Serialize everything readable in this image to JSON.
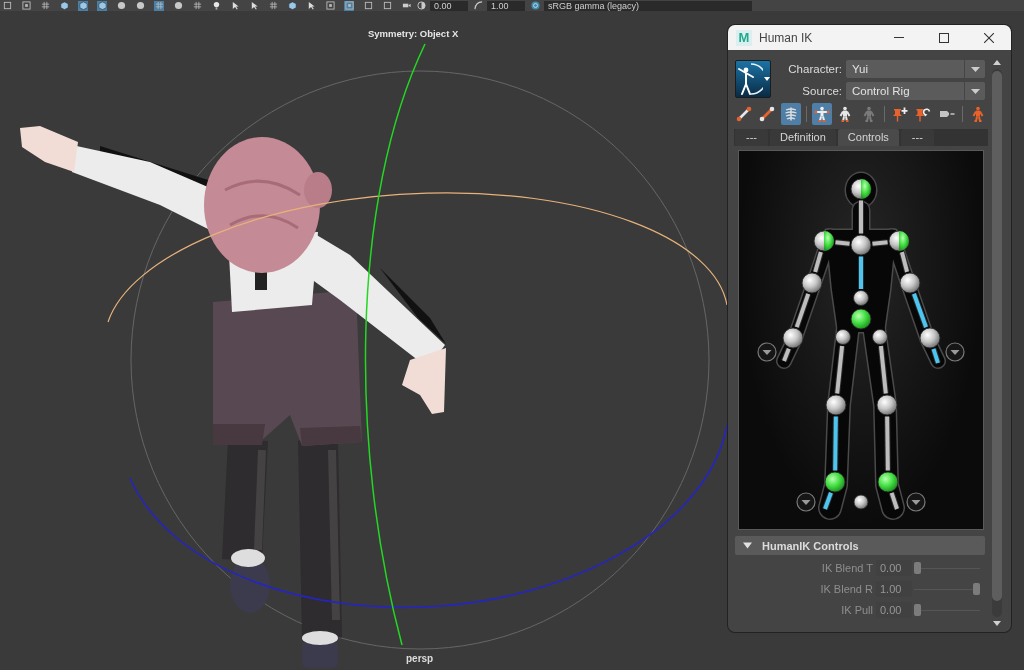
{
  "top_toolbar": {
    "tools": [
      {
        "kind": "square",
        "selected": false
      },
      {
        "kind": "frame",
        "selected": false
      },
      {
        "kind": "grid",
        "selected": false
      },
      {
        "kind": "cube",
        "selected": false
      },
      {
        "kind": "cube",
        "selected": true
      },
      {
        "kind": "cube",
        "selected": true
      },
      {
        "kind": "sphere",
        "selected": false
      },
      {
        "kind": "sphere",
        "selected": false
      },
      {
        "kind": "grid",
        "selected": true
      },
      {
        "kind": "sphere",
        "selected": false
      },
      {
        "kind": "grid",
        "selected": false
      },
      {
        "kind": "light",
        "selected": false
      },
      {
        "kind": "arrow",
        "selected": false
      },
      {
        "kind": "arrow",
        "selected": false
      },
      {
        "kind": "grid",
        "selected": false
      },
      {
        "kind": "cube",
        "selected": false
      },
      {
        "kind": "arrow",
        "selected": false
      },
      {
        "kind": "frame",
        "selected": false
      },
      {
        "kind": "frame",
        "selected": true
      },
      {
        "kind": "square",
        "selected": false
      },
      {
        "kind": "square",
        "selected": false
      },
      {
        "kind": "camera",
        "selected": false
      }
    ],
    "exposure": "0.00",
    "gamma": "1.00",
    "color_space": "sRGB gamma (legacy)"
  },
  "viewport": {
    "symmetry_label": "Symmetry: Object X",
    "camera_label": "persp"
  },
  "human_ik": {
    "logo": "M",
    "title": "Human IK",
    "character": {
      "label": "Character:",
      "value": "Yui"
    },
    "source": {
      "label": "Source:",
      "value": "Control Rig"
    },
    "toolbar": [
      {
        "tools": [
          {
            "kind": "bone",
            "selected": false
          },
          {
            "kind": "limb",
            "selected": false
          },
          {
            "kind": "skeleton",
            "selected": true
          }
        ]
      },
      {
        "tools": [
          {
            "kind": "tpose",
            "selected": true
          },
          {
            "kind": "figure",
            "selected": false
          },
          {
            "kind": "ghost",
            "selected": false
          }
        ]
      },
      {
        "tools": [
          {
            "kind": "pinadd",
            "selected": false
          },
          {
            "kind": "pinrotate",
            "selected": false
          },
          {
            "kind": "release",
            "selected": false
          }
        ]
      },
      {
        "tools": [
          {
            "kind": "person",
            "selected": false
          }
        ]
      }
    ],
    "tabs": [
      {
        "label": "---",
        "selected": false
      },
      {
        "label": "Definition",
        "selected": false
      },
      {
        "label": "Controls",
        "selected": true
      },
      {
        "label": "---",
        "selected": false
      }
    ],
    "figure": {
      "effectors": [
        {
          "kind": "half"
        },
        {
          "kind": "plain"
        },
        {
          "kind": "half"
        },
        {
          "kind": "half"
        },
        {
          "kind": "plain"
        },
        {
          "kind": "plain"
        },
        {
          "kind": "plain"
        },
        {
          "kind": "plain"
        },
        {
          "kind": "plain"
        },
        {
          "kind": "full"
        },
        {
          "kind": "plain"
        },
        {
          "kind": "plain"
        },
        {
          "kind": "plain"
        },
        {
          "kind": "plain"
        },
        {
          "kind": "full"
        },
        {
          "kind": "full"
        },
        {
          "kind": "plain"
        }
      ],
      "bones": [
        {
          "selected": false
        },
        {
          "selected": false
        },
        {
          "selected": false
        },
        {
          "selected": true
        },
        {
          "selected": false
        },
        {
          "selected": false
        },
        {
          "selected": false
        },
        {
          "selected": false
        },
        {
          "selected": true
        },
        {
          "selected": true
        },
        {
          "selected": false
        },
        {
          "selected": true
        },
        {
          "selected": true
        },
        {
          "selected": false
        },
        {
          "selected": false
        },
        {
          "selected": false
        }
      ]
    },
    "controls": {
      "title": "HumanIK Controls",
      "expanded": true,
      "rows": [
        {
          "label": "IK Blend T",
          "value": "0.00",
          "level": 0,
          "disabled": true
        },
        {
          "label": "IK Blend R",
          "value": "1.00",
          "level": 1,
          "disabled": true
        },
        {
          "label": "IK Pull",
          "value": "0.00",
          "level": 0,
          "disabled": true
        }
      ]
    }
  }
}
